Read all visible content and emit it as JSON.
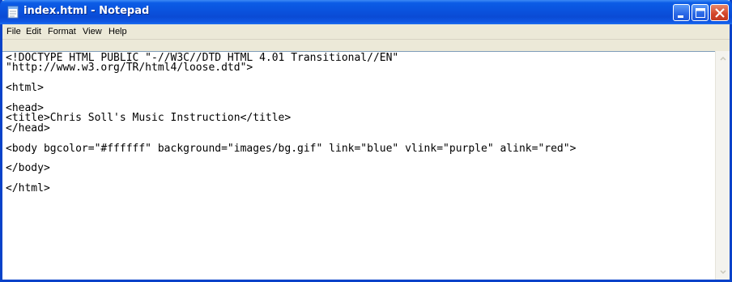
{
  "window": {
    "title": "index.html - Notepad"
  },
  "menu": {
    "items": [
      {
        "label": "File"
      },
      {
        "label": "Edit"
      },
      {
        "label": "Format"
      },
      {
        "label": "View"
      },
      {
        "label": "Help"
      }
    ]
  },
  "editor": {
    "lines": [
      "<!DOCTYPE HTML PUBLIC \"-//W3C//DTD HTML 4.01 Transitional//EN\"",
      "\"http://www.w3.org/TR/html4/loose.dtd\">",
      "",
      "<html>",
      "",
      "<head>",
      "<title>Chris Soll's Music Instruction</title>",
      "</head>",
      "",
      "<body bgcolor=\"#ffffff\" background=\"images/bg.gif\" link=\"blue\" vlink=\"purple\" alink=\"red\">",
      "",
      "</body>",
      "",
      "</html>"
    ]
  },
  "icons": {
    "app": "notepad-icon",
    "minimize": "minimize-icon",
    "maximize": "maximize-icon",
    "close": "close-icon",
    "scroll_up": "scroll-up-arrow-icon",
    "scroll_down": "scroll-down-arrow-icon"
  },
  "colors": {
    "titlebar": "#0a52dd",
    "close_button": "#d2452a",
    "window_frame": "#0842c9"
  }
}
